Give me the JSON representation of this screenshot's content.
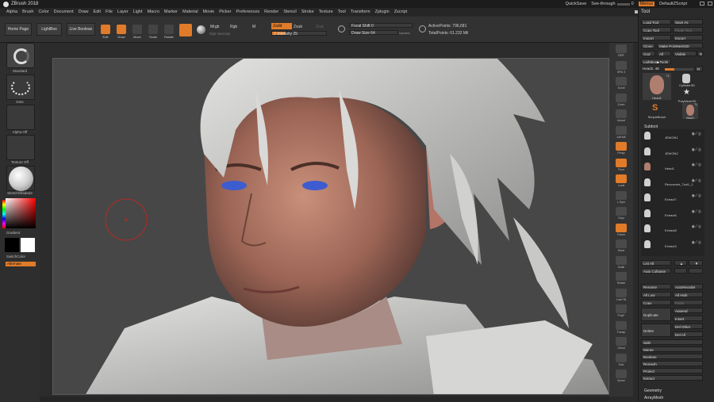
{
  "app": {
    "title": "ZBrush 2018"
  },
  "quick": {
    "quicksave": "QuickSave",
    "see_through_label": "See-through",
    "see_through_value": "0",
    "see_through_fraction": 0.0,
    "menus": "Menus",
    "defaultzscript": "DefaultZScript"
  },
  "menubar": [
    "Alpha",
    "Brush",
    "Color",
    "Document",
    "Draw",
    "Edit",
    "File",
    "Layer",
    "Light",
    "Macro",
    "Marker",
    "Material",
    "Movie",
    "Picker",
    "Preferences",
    "Render",
    "Stencil",
    "Stroke",
    "Texture",
    "Tool",
    "Transform",
    "Zplugin",
    "Zscript"
  ],
  "shelf": {
    "home_page": "Home Page",
    "lightbox": "LightBox",
    "live_boolean": "Live Boolean",
    "edit": "Edit",
    "draw": "Draw",
    "move": "Move",
    "scale": "Scale",
    "rotate": "Rotate",
    "mrgb": "Mrgb",
    "rgb": "Rgb",
    "m": "M",
    "zadd": "Zadd",
    "zsub": "Zsub",
    "zcut": "Zcut",
    "rgb_intensity": "Rgb Intensity",
    "z_intensity": "Z Intensity 25",
    "z_intensity_fraction": 0.25,
    "focal_shift": "Focal Shift 0",
    "draw_size": "Draw Size 64",
    "dynamic": "Dynamic",
    "active_points": "ActivePoints: 796,681",
    "total_points": "TotalPoints: 61.232 Mil"
  },
  "left": {
    "standard": "Standard",
    "dots": "Dots",
    "alpha_off": "Alpha Off",
    "texture_off": "Texture Off",
    "material": "SketchShaded2",
    "gradient": "Gradient",
    "switchcolor": "SwitchColor",
    "alternate": "Alternate"
  },
  "rightshelf": [
    "BPR",
    "SPix 3",
    "Scroll",
    "Zoom",
    "Actual",
    "AAHalf",
    "Persp",
    "Floor",
    "Local",
    "L.Sym",
    "Gxyz",
    "Frame",
    "Move",
    "Scale",
    "Rotate",
    "Line Fill",
    "PolyF",
    "Transp",
    "Ghost",
    "Solo",
    "Xpose"
  ],
  "tool": {
    "title": "Tool",
    "load_tool": "Load Tool",
    "save_as": "Save As",
    "copy_tool": "Copy Tool",
    "paste_tool": "Paste Tool",
    "import": "Import",
    "export": "Export",
    "clone": "Clone",
    "make_polymesh": "Make PolyMesh3D",
    "goz": "GoZ",
    "all": "All",
    "visible": "Visible",
    "r": "R",
    "lightbox_tools": "Lightbox▶Tools",
    "head1_label": "Head1. 48",
    "thumbs": [
      "Head1",
      "Cylinder3D",
      "PolyMesh3D",
      "SimpleBrush",
      "Head1"
    ],
    "thumb_count1": "71",
    "thumb_count2": "71",
    "subtool": "Subtool",
    "subtools": [
      "JEWON1",
      "JEWON2",
      "Head1",
      "Recovered_Tool1_1",
      "Extract7",
      "Extract6",
      "Extract8",
      "Extract3"
    ],
    "list_all": "List All",
    "auto_collapse": "Auto Collapse",
    "rename": "Rename",
    "autoreorder": "AutoReorder",
    "all_low": "All Low",
    "all_high": "All High",
    "copy": "Copy",
    "paste": "Paste",
    "duplicate": "Duplicate",
    "append": "Append",
    "insert": "Insert",
    "delete": "Delete",
    "del_other": "Del Other",
    "del_all": "Del All",
    "split": "Split",
    "merge": "Merge",
    "boolean": "Boolean",
    "remesh": "Remesh",
    "project": "Project",
    "extract": "Extract",
    "geometry": "Geometry",
    "arraymesh": "ArrayMesh"
  },
  "colors": {
    "accent": "#e07b29",
    "panel": "#2a2a2a",
    "canvas": "#474747"
  }
}
